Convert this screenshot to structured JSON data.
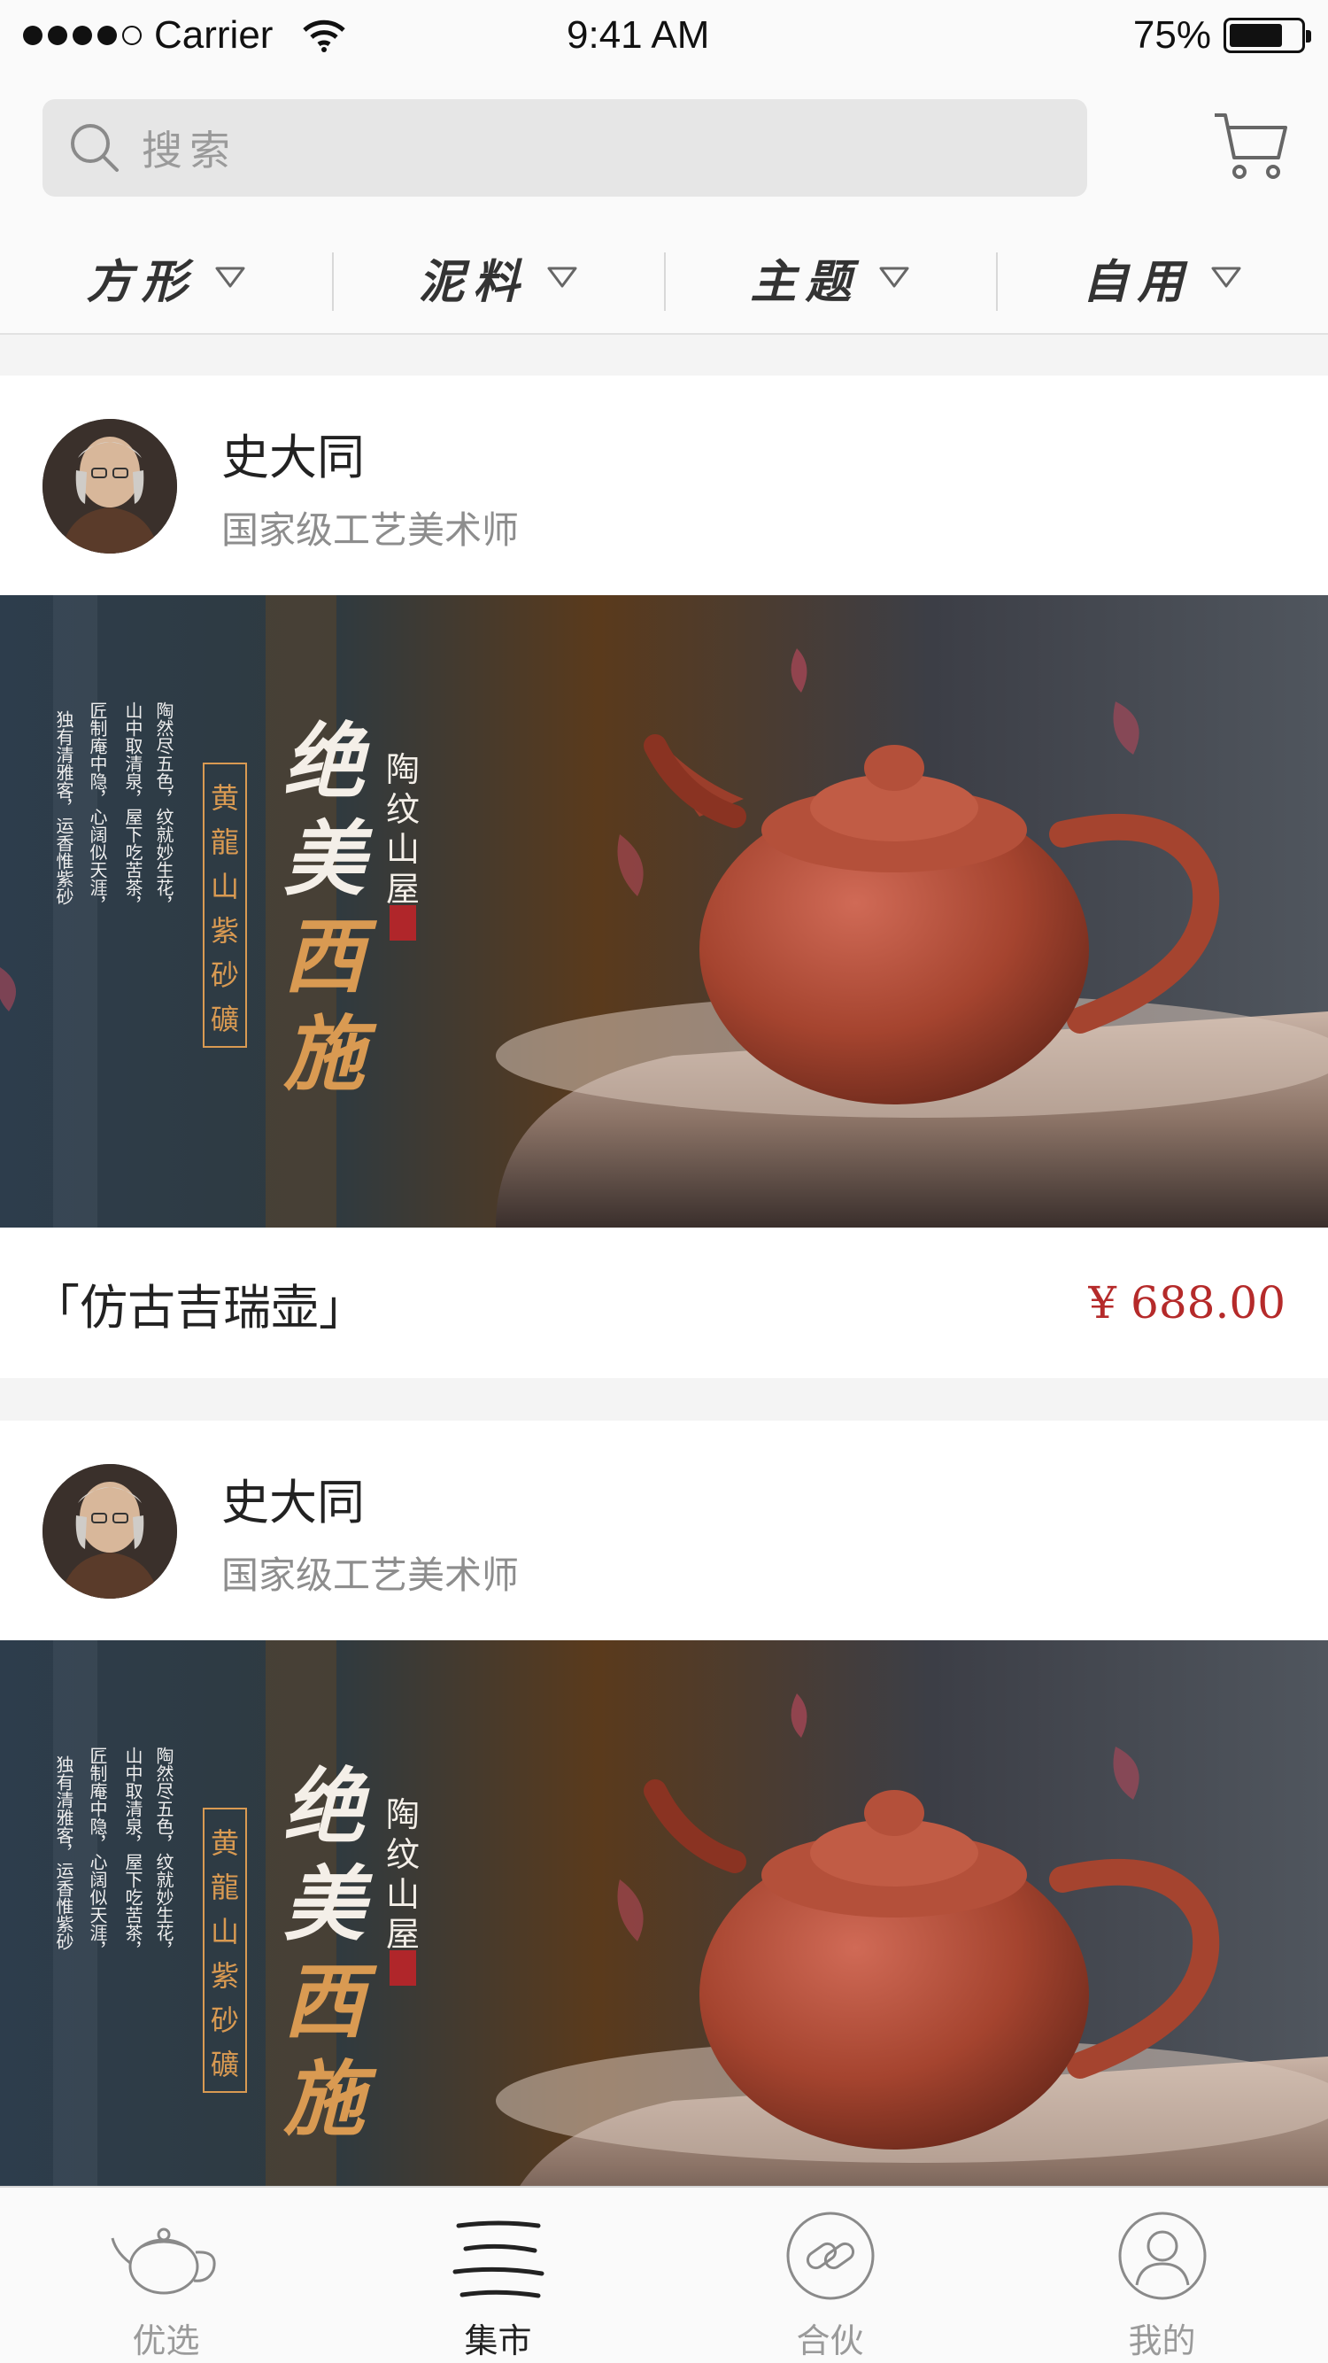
{
  "status_bar": {
    "carrier": "Carrier",
    "time": "9:41 AM",
    "battery_percent": "75%",
    "battery_level": 0.75
  },
  "search": {
    "placeholder": "搜索"
  },
  "filters": [
    {
      "label": "方形",
      "active": true
    },
    {
      "label": "泥料",
      "active": false
    },
    {
      "label": "主题",
      "active": false
    },
    {
      "label": "自用",
      "active": true
    }
  ],
  "feed": [
    {
      "author_name": "史大同",
      "author_title": "国家级工艺美术师",
      "banner": {
        "calligraphy_title": "绝美西施",
        "side_vertical": "陶纹山屋",
        "boxed_text": "黄龍山紫砂礦",
        "poem_lines": [
          "陶然尽五色，纹就妙生花，",
          "山中取清泉，屋下吃苦茶，",
          "匠制庵中隐，心阔似天涯，",
          "独有清雅客，运香惟紫砂"
        ]
      },
      "product_name": "「仿古吉瑞壶」",
      "price": "¥ 688.00"
    },
    {
      "author_name": "史大同",
      "author_title": "国家级工艺美术师",
      "banner": {
        "calligraphy_title": "绝美西施",
        "side_vertical": "陶纹山屋",
        "boxed_text": "黄龍山紫砂礦",
        "poem_lines": [
          "陶然尽五色，纹就妙生花，",
          "山中取清泉，屋下吃苦茶，",
          "匠制庵中隐，心阔似天涯，",
          "独有清雅客，运香惟紫砂"
        ]
      }
    }
  ],
  "tabs": [
    {
      "label": "优选",
      "icon": "teapot-icon",
      "active": false
    },
    {
      "label": "集市",
      "icon": "market-lines-icon",
      "active": true
    },
    {
      "label": "合伙",
      "icon": "link-icon",
      "active": false
    },
    {
      "label": "我的",
      "icon": "user-icon",
      "active": false
    }
  ],
  "colors": {
    "accent": "#b52a2a",
    "banner_gold": "#d99a52"
  }
}
